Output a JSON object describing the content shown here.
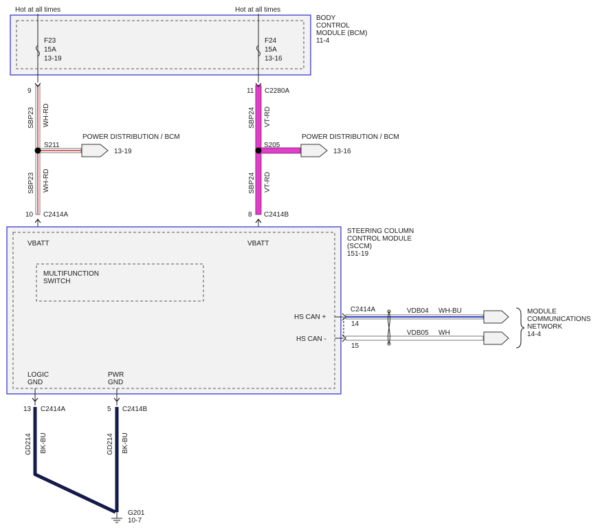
{
  "colors": {
    "wh_rd_center": "#d96a6a",
    "vt_rd": "#e040c8",
    "bk_bu": "#141a4a",
    "wh_bu_center": "#3040c0",
    "box_border": "#3a3ad0"
  },
  "top_labels": {
    "left": "Hot at all times",
    "right": "Hot at all times"
  },
  "bcm": {
    "name": [
      "BODY",
      "CONTROL",
      "MODULE (BCM)",
      "11-4"
    ],
    "fuse_f23": {
      "name": "F23",
      "rating": "15A",
      "ref": "13-19"
    },
    "fuse_f24": {
      "name": "F24",
      "rating": "15A",
      "ref": "13-16"
    }
  },
  "left_branch": {
    "pin_top": "9",
    "pin_bottom": "10",
    "connector_bottom": "C2414A",
    "circuit_upper": "SBP23",
    "color_upper": "WH-RD",
    "circuit_lower": "SBP23",
    "color_lower": "WH-RD",
    "splice": "S211",
    "dest": "POWER DISTRIBUTION / BCM",
    "dest_ref": "13-19"
  },
  "right_branch": {
    "pin_top": "11",
    "connector_top": "C2280A",
    "pin_bottom": "8",
    "connector_bottom": "C2414B",
    "circuit_upper": "SBP24",
    "color_upper": "VT-RD",
    "circuit_lower": "SBP24",
    "color_lower": "VT-RD",
    "splice": "S205",
    "dest": "POWER DISTRIBUTION / BCM",
    "dest_ref": "13-16"
  },
  "sccm": {
    "name": [
      "STEERING COLUMN",
      "CONTROL MODULE",
      "(SCCM)",
      "151-19"
    ],
    "vbatt_left": "VBATT",
    "vbatt_right": "VBATT",
    "switch": [
      "MULTIFUNCTION",
      "SWITCH"
    ],
    "hs_can_plus": "HS CAN +",
    "hs_can_minus": "HS CAN -",
    "logic_gnd": [
      "LOGIC",
      "GND"
    ],
    "pwr_gnd": [
      "PWR",
      "GND"
    ]
  },
  "can": {
    "connector": "C2414A",
    "pin_plus": "14",
    "pin_minus": "15",
    "circuit_plus": "VDB04",
    "color_plus": "WH-BU",
    "circuit_minus": "VDB05",
    "color_minus": "WH",
    "network": [
      "MODULE",
      "COMMUNICATIONS",
      "NETWORK",
      "14-4"
    ]
  },
  "ground": {
    "left": {
      "pin": "13",
      "connector": "C2414A",
      "circuit": "GD214",
      "color": "BK-BU"
    },
    "right": {
      "pin": "5",
      "connector": "C2414B",
      "circuit": "GD214",
      "color": "BK-BU"
    },
    "point": "G201",
    "point_ref": "10-7"
  }
}
